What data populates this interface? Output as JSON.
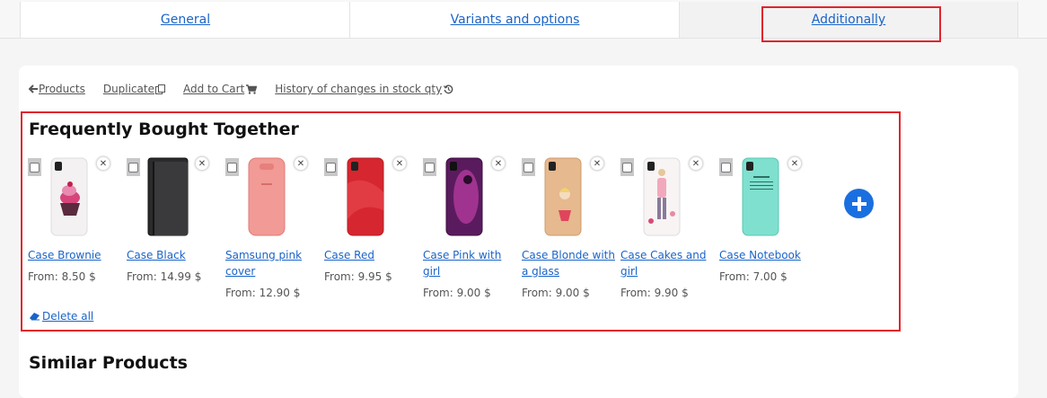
{
  "tabs": [
    {
      "label": "General"
    },
    {
      "label": "Variants and options"
    },
    {
      "label": "Additionally"
    }
  ],
  "toolbar": {
    "products": "Products",
    "duplicate": "Duplicate",
    "add_to_cart": "Add to Cart",
    "history": "History of changes in stock qty"
  },
  "fbt": {
    "title": "Frequently Bought Together",
    "delete_all": "Delete all",
    "products": [
      {
        "name": "Case Brownie",
        "price": "From: 8.50 $",
        "image": "case-brownie-image"
      },
      {
        "name": "Case Black",
        "price": "From: 14.99 $",
        "image": "case-black-image"
      },
      {
        "name": "Samsung pink cover",
        "price": "From: 12.90 $",
        "image": "samsung-pink-cover-image"
      },
      {
        "name": "Case Red",
        "price": "From: 9.95 $",
        "image": "case-red-image"
      },
      {
        "name": "Case Pink with girl",
        "price": "From: 9.00 $",
        "image": "case-pink-girl-image"
      },
      {
        "name": "Case Blonde with a glass",
        "price": "From: 9.00 $",
        "image": "case-blonde-image"
      },
      {
        "name": "Case Cakes and girl",
        "price": "From: 9.90 $",
        "image": "case-cakes-girl-image"
      },
      {
        "name": "Case Notebook",
        "price": "From: 7.00 $",
        "image": "case-notebook-image"
      }
    ]
  },
  "similar": {
    "title": "Similar Products"
  },
  "colors": {
    "link": "#1a64c8",
    "highlight": "#e0252b",
    "add_button": "#1a6fe0"
  }
}
